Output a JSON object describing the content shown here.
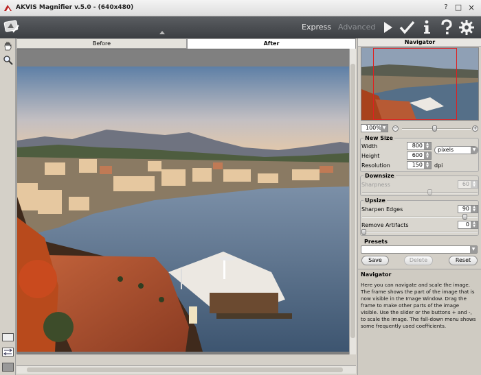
{
  "window": {
    "title": "AKVIS Magnifier v.5.0 -  (640x480)",
    "controls": [
      "?",
      "□",
      "×"
    ]
  },
  "toolbar": {
    "modes": {
      "express": "Express",
      "advanced": "Advanced"
    },
    "icons": [
      "run-icon",
      "apply-checkmark-icon",
      "info-icon",
      "help-icon",
      "settings-gear-icon"
    ]
  },
  "tabs": {
    "before": "Before",
    "after": "After"
  },
  "panel": {
    "navigator": {
      "title": "Navigator",
      "zoom": "100%"
    },
    "new_size": {
      "title": "New Size",
      "width_label": "Width",
      "width_value": "800",
      "height_label": "Height",
      "height_value": "600",
      "unit": "pixels",
      "resolution_label": "Resolution",
      "resolution_value": "150",
      "resolution_unit": "dpi"
    },
    "downsize": {
      "title": "Downsize",
      "sharpness_label": "Sharpness",
      "sharpness_value": "60"
    },
    "upsize": {
      "title": "Upsize",
      "sharpen_label": "Sharpen Edges",
      "sharpen_value": "90",
      "sharpen_level": 0.9,
      "artifacts_label": "Remove Artifacts",
      "artifacts_value": "0",
      "artifacts_level": 0
    },
    "presets": {
      "title": "Presets",
      "selected": "",
      "save": "Save",
      "delete": "Delete",
      "reset": "Reset"
    },
    "help": {
      "title": "Navigator",
      "text": "Here you can navigate and scale the image. The frame shows the part of the image that is now visible in the Image Window. Drag the frame to make other parts of the image visible. Use the slider or the buttons + and -, to scale the image. The fall-down menu shows some frequently used coefficients."
    }
  },
  "colors": {
    "toolbar_bg": "#4a4d51",
    "express_active": "#e8e8e8",
    "advanced_inactive": "#8d9094",
    "navigator_frame": "#e02020"
  }
}
